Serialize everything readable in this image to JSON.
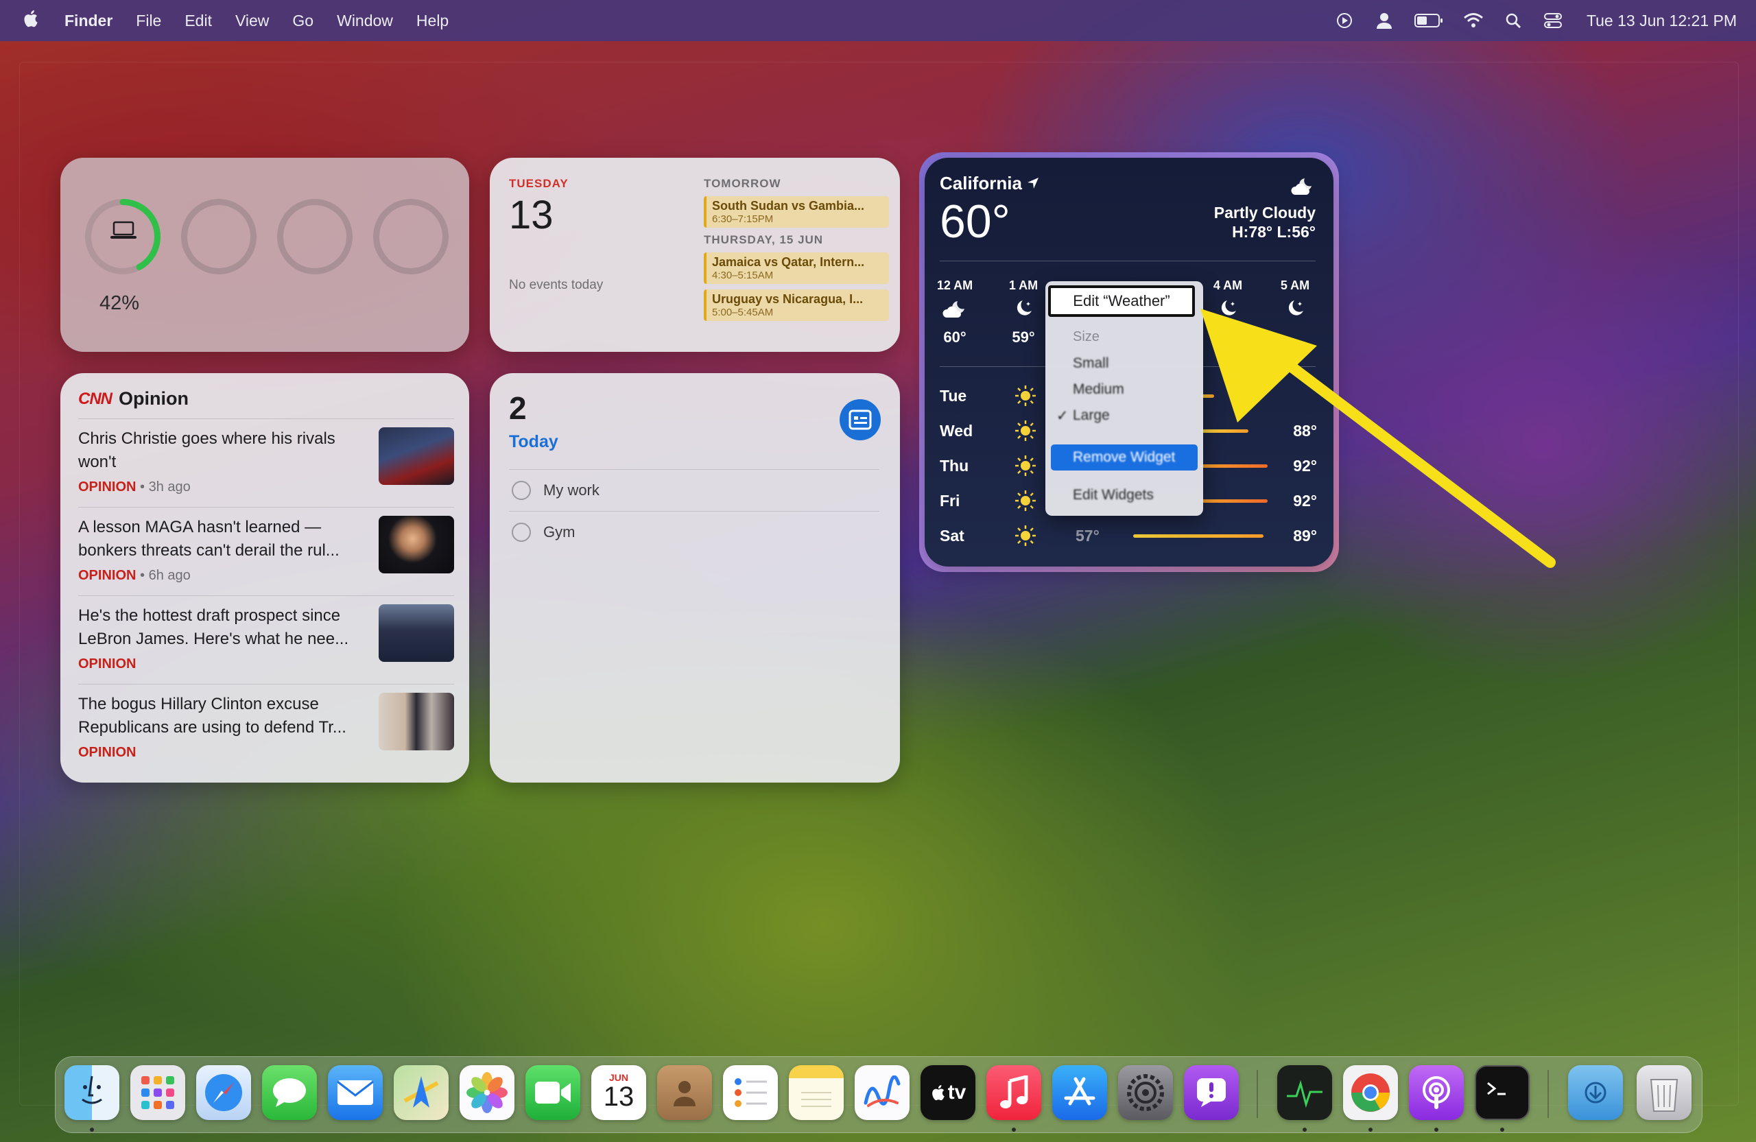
{
  "menubar": {
    "apple_label": "",
    "app_name": "Finder",
    "menus": [
      "File",
      "Edit",
      "View",
      "Go",
      "Window",
      "Help"
    ],
    "clock": "Tue 13 Jun  12:21 PM",
    "status_icons": [
      "screen-record-icon",
      "user-icon",
      "battery-icon",
      "wifi-icon",
      "spotlight-icon",
      "control-center-icon"
    ]
  },
  "battery_widget": {
    "percent": "42%",
    "level": 0.42,
    "color": "#30c04a"
  },
  "calendar_widget": {
    "weekday": "TUESDAY",
    "date": "13",
    "no_events": "No events today",
    "tomorrow_header": "TOMORROW",
    "thursday_header": "THURSDAY, 15 JUN",
    "events": [
      {
        "title": "South Sudan vs Gambia...",
        "time": "6:30–7:15PM"
      },
      {
        "title": "Jamaica vs Qatar, Intern...",
        "time": "4:30–5:15AM"
      },
      {
        "title": "Uruguay vs Nicaragua, I...",
        "time": "5:00–5:45AM"
      }
    ]
  },
  "news_widget": {
    "brand": "CNN",
    "title": "Opinion",
    "items": [
      {
        "headline": "Chris Christie goes where his rivals won't",
        "tag": "OPINION",
        "age": " • 3h ago"
      },
      {
        "headline": "A lesson MAGA hasn't learned — bonkers threats can't derail the rul...",
        "tag": "OPINION",
        "age": " • 6h ago"
      },
      {
        "headline": "He's the hottest draft prospect since LeBron James. Here's what he nee...",
        "tag": "OPINION",
        "age": ""
      },
      {
        "headline": "The bogus Hillary Clinton excuse Republicans are using to defend Tr...",
        "tag": "OPINION",
        "age": ""
      }
    ]
  },
  "reminders_widget": {
    "count": "2",
    "label": "Today",
    "items": [
      "My work",
      "Gym"
    ]
  },
  "weather_widget": {
    "location": "California",
    "temp": "60°",
    "condition": "Partly Cloudy",
    "hilo": "H:78° L:56°",
    "hourly": [
      {
        "time": "12 AM",
        "icon": "cloud-moon-icon",
        "temp": "60°"
      },
      {
        "time": "1 AM",
        "icon": "moon-icon",
        "temp": "59°"
      },
      {
        "time": "4 AM",
        "icon": "moon-icon",
        "temp": ""
      },
      {
        "time": "5 AM",
        "icon": "moon-icon",
        "temp": ""
      }
    ],
    "daily": [
      {
        "day": "Tue",
        "low": "",
        "high": ""
      },
      {
        "day": "Wed",
        "low": "",
        "high": "88°"
      },
      {
        "day": "Thu",
        "low": "",
        "high": "92°"
      },
      {
        "day": "Fri",
        "low": "",
        "high": "92°"
      },
      {
        "day": "Sat",
        "low": "57°",
        "high": "89°"
      }
    ]
  },
  "context_menu": {
    "edit": "Edit “Weather”",
    "size_header": "Size",
    "sizes": [
      "Small",
      "Medium",
      "Large"
    ],
    "checked_mark": "✓",
    "remove": "Remove Widget",
    "edit_widgets": "Edit Widgets"
  },
  "dock": {
    "apps": [
      "Finder",
      "Launchpad",
      "Safari",
      "Messages",
      "Mail",
      "Maps",
      "Photos",
      "FaceTime",
      "Calendar",
      "Contacts",
      "Reminders",
      "Notes",
      "Freeform",
      "TV",
      "Music",
      "App Store",
      "System Settings",
      "Feedback Assistant",
      "Activity Monitor",
      "Chrome",
      "Podcasts",
      "Terminal",
      "Downloads",
      "Trash"
    ],
    "calendar_month": "JUN",
    "calendar_day": "13",
    "tv_label": "tv"
  }
}
